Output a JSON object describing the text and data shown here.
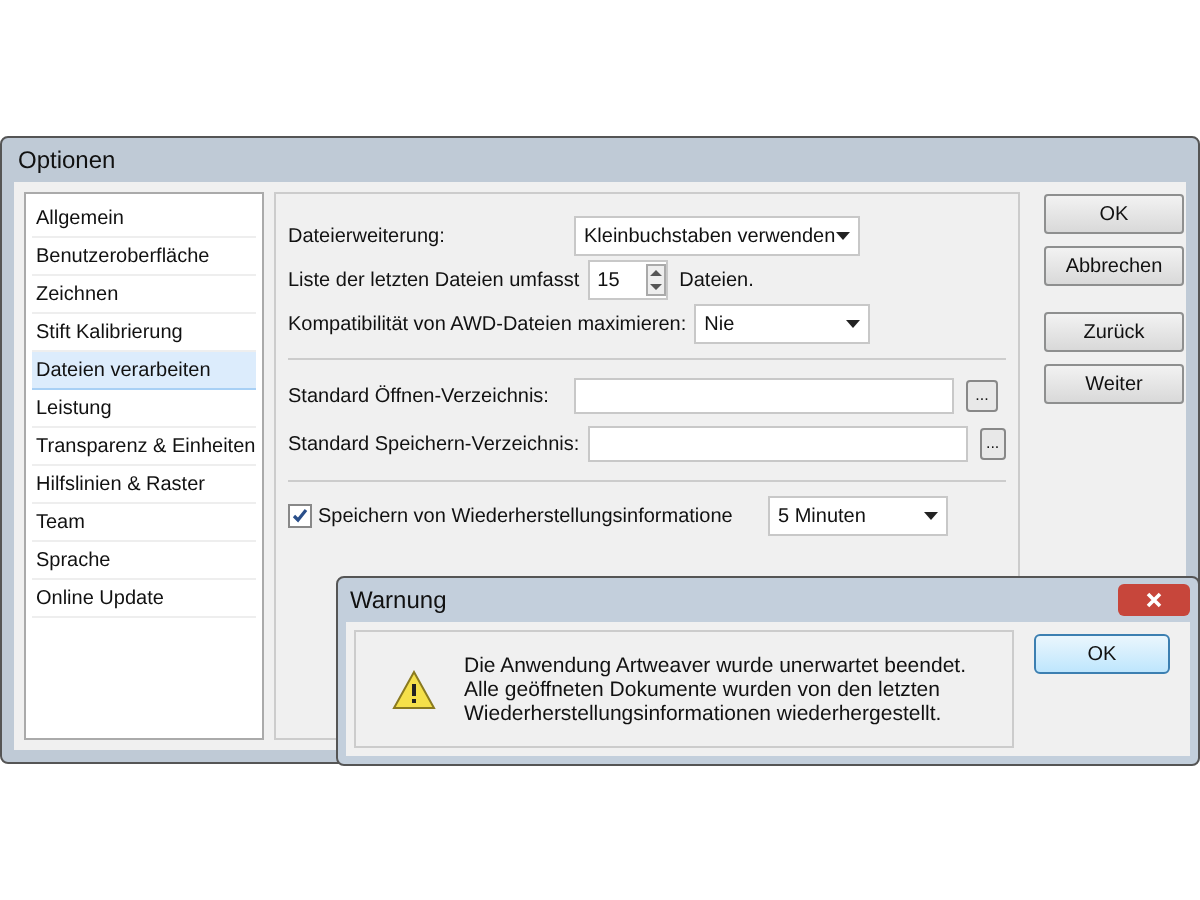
{
  "window": {
    "title": "Optionen"
  },
  "sidebar": {
    "items": [
      {
        "label": "Allgemein",
        "selected": false
      },
      {
        "label": "Benutzeroberfläche",
        "selected": false
      },
      {
        "label": "Zeichnen",
        "selected": false
      },
      {
        "label": "Stift Kalibrierung",
        "selected": false
      },
      {
        "label": "Dateien verarbeiten",
        "selected": true
      },
      {
        "label": "Leistung",
        "selected": false
      },
      {
        "label": "Transparenz & Einheiten",
        "selected": false
      },
      {
        "label": "Hilfslinien & Raster",
        "selected": false
      },
      {
        "label": "Team",
        "selected": false
      },
      {
        "label": "Sprache",
        "selected": false
      },
      {
        "label": "Online Update",
        "selected": false
      }
    ]
  },
  "settings": {
    "extension": {
      "label": "Dateierweiterung:",
      "value": "Kleinbuchstaben verwenden"
    },
    "recent": {
      "label": "Liste der letzten Dateien umfasst",
      "value": "15",
      "suffix": "Dateien."
    },
    "compat": {
      "label": "Kompatibilität von AWD-Dateien maximieren:",
      "value": "Nie"
    },
    "open_dir": {
      "label": "Standard Öffnen-Verzeichnis:",
      "browse": "..."
    },
    "save_dir": {
      "label": "Standard Speichern-Verzeichnis:",
      "browse": "..."
    },
    "recovery": {
      "label": "Speichern von Wiederherstellungsinformatione",
      "checked": true,
      "value": "5 Minuten"
    }
  },
  "buttons": [
    {
      "label": "OK",
      "kind": "primary"
    },
    {
      "label": "Abbrechen",
      "kind": "primary"
    },
    {
      "label": "Zurück",
      "kind": "nav"
    },
    {
      "label": "Weiter",
      "kind": "nav"
    }
  ],
  "warning": {
    "title": "Warnung",
    "message": "Die Anwendung Artweaver wurde unerwartet beendet. Alle geöffneten Dokumente wurden von den letzten Wiederherstellungsinformationen wiederhergestellt.",
    "button": "OK"
  }
}
